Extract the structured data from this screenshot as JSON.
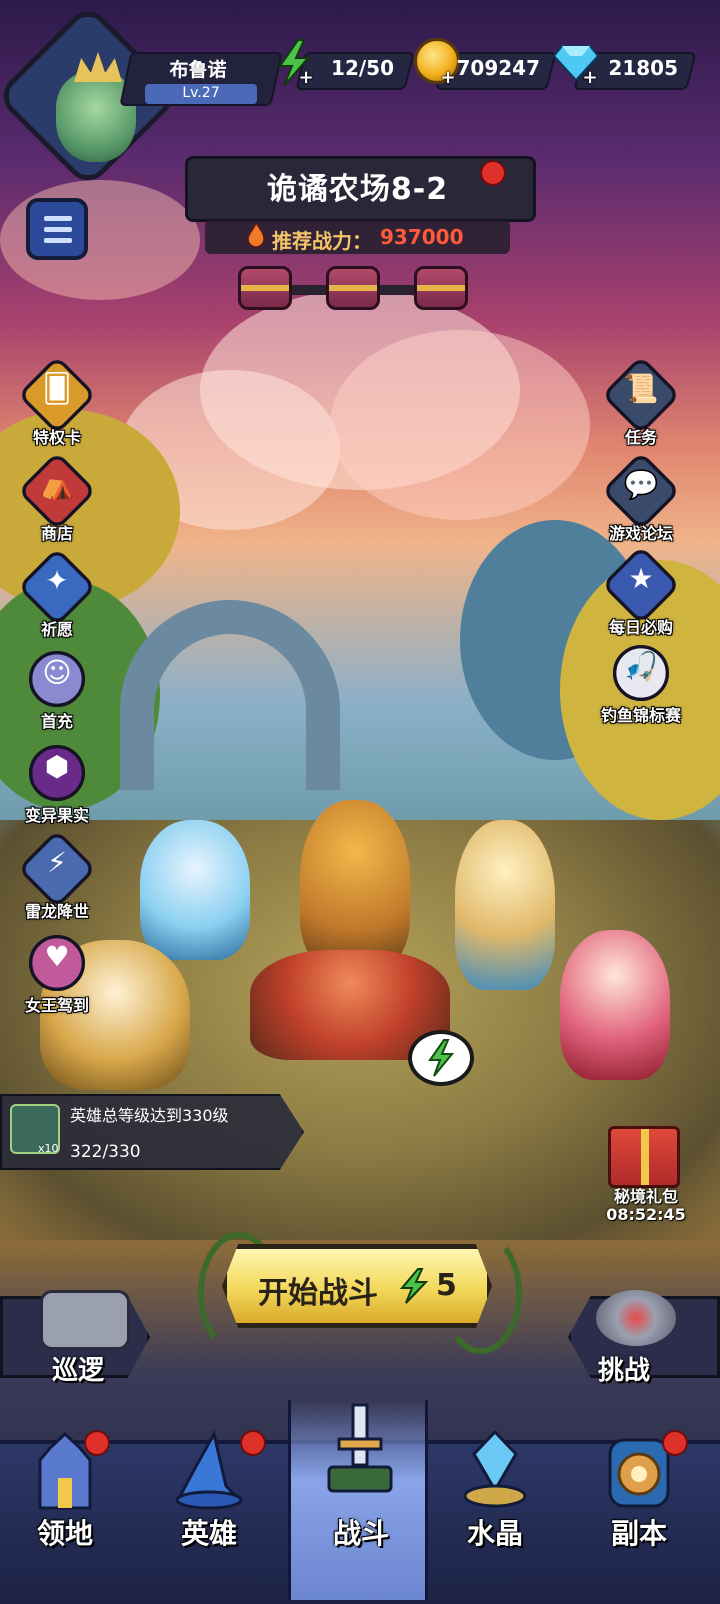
{
  "player": {
    "name": "布鲁诺",
    "level": "Lv.27"
  },
  "resources": {
    "energy": "12/50",
    "gold": "709247",
    "gems": "21805"
  },
  "stage": {
    "title": "诡谲农场8-2",
    "power_label": "推荐战力：",
    "power_value": "937000"
  },
  "left_menu": [
    {
      "label": "特权卡",
      "icon": "privilege-card-icon"
    },
    {
      "label": "商店",
      "icon": "shop-icon"
    },
    {
      "label": "祈愿",
      "icon": "wish-icon"
    },
    {
      "label": "首充",
      "icon": "first-recharge-icon"
    },
    {
      "label": "变异果实",
      "icon": "mutant-fruit-icon"
    },
    {
      "label": "雷龙降世",
      "icon": "thunder-dragon-icon"
    },
    {
      "label": "女王驾到",
      "icon": "queen-icon"
    }
  ],
  "right_menu": [
    {
      "label": "任务",
      "icon": "task-icon"
    },
    {
      "label": "游戏论坛",
      "icon": "forum-icon"
    },
    {
      "label": "每日必购",
      "icon": "daily-deal-icon"
    },
    {
      "label": "钓鱼锦标赛",
      "icon": "fishing-icon"
    }
  ],
  "quest": {
    "title": "英雄总等级达到330级",
    "progress": "322/330",
    "reward_multiplier": "x10"
  },
  "gift": {
    "label": "秘境礼包",
    "timer": "08:52:45"
  },
  "start_battle": {
    "label": "开始战斗",
    "cost": "5"
  },
  "patrol": {
    "label": "巡逻"
  },
  "challenge": {
    "label": "挑战"
  },
  "bottom_nav": [
    {
      "label": "领地",
      "active": false
    },
    {
      "label": "英雄",
      "active": false
    },
    {
      "label": "战斗",
      "active": true
    },
    {
      "label": "水晶",
      "active": false
    },
    {
      "label": "副本",
      "active": false
    }
  ],
  "colors": {
    "accent_yellow": "#f2d85a",
    "power_red": "#ff5a3a",
    "nav_active": "#8aa4e8",
    "badge_red": "#e0302a"
  }
}
